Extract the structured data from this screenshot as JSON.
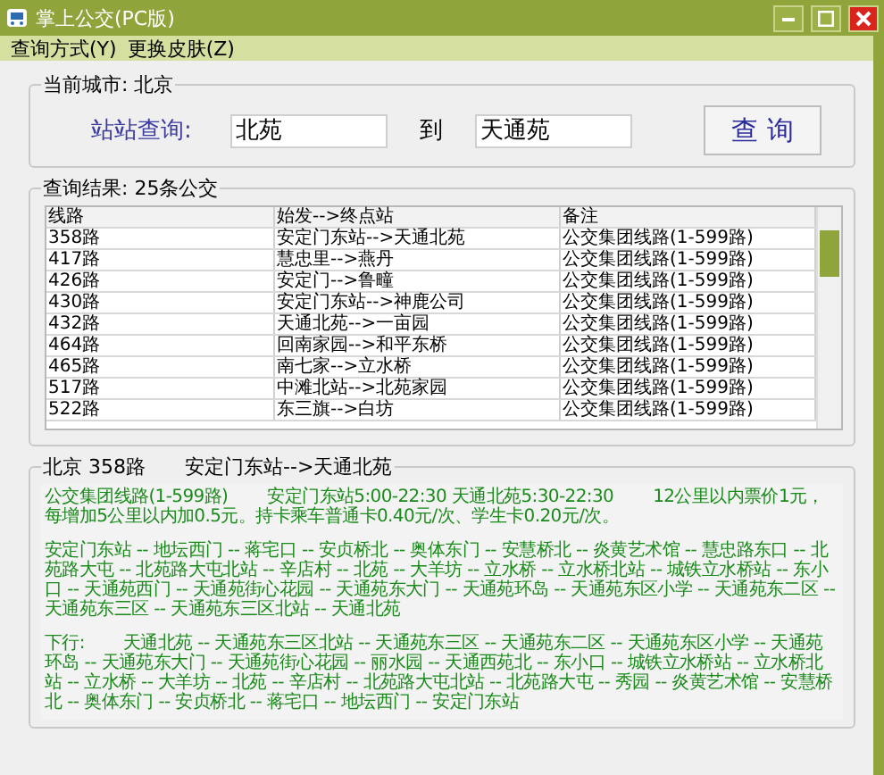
{
  "window": {
    "title": "掌上公交(PC版)"
  },
  "menu": [
    "查询方式(Y)",
    "更换皮肤(Z)"
  ],
  "query": {
    "legend": "当前城市: 北京",
    "label": "站站查询:",
    "from": "北苑",
    "to_label": "到",
    "to": "天通苑",
    "button": "查 询"
  },
  "results": {
    "legend": "查询结果: 25条公交",
    "columns": [
      "线路",
      "始发-->终点站",
      "备注"
    ],
    "rows": [
      [
        "358路",
        "安定门东站-->天通北苑",
        "公交集团线路(1-599路)"
      ],
      [
        "417路",
        "慧忠里-->燕丹",
        "公交集团线路(1-599路)"
      ],
      [
        "426路",
        "安定门-->鲁疃",
        "公交集团线路(1-599路)"
      ],
      [
        "430路",
        "安定门东站-->神鹿公司",
        "公交集团线路(1-599路)"
      ],
      [
        "432路",
        "天通北苑-->一亩园",
        "公交集团线路(1-599路)"
      ],
      [
        "464路",
        "回南家园-->和平东桥",
        "公交集团线路(1-599路)"
      ],
      [
        "465路",
        "南七家-->立水桥",
        "公交集团线路(1-599路)"
      ],
      [
        "517路",
        "中滩北站-->北苑家园",
        "公交集团线路(1-599路)"
      ],
      [
        "522路",
        "东三旗-->白坊",
        "公交集团线路(1-599路)"
      ]
    ]
  },
  "detail": {
    "legend": [
      "北京 358路",
      "安定门东站-->天通北苑"
    ],
    "info": [
      "公交集团线路(1-599路)",
      "安定门东站5:00-22:30 天通北苑5:30-22:30",
      "12公里以内票价1元，每增加5公里以内加0.5元。持卡乘车普通卡0.40元/次、学生卡0.20元/次。"
    ],
    "up_stops": "安定门东站 -- 地坛西门 -- 蒋宅口 -- 安贞桥北 -- 奥体东门 -- 安慧桥北 -- 炎黄艺术馆 -- 慧忠路东口 -- 北苑路大屯 -- 北苑路大屯北站 -- 辛店村 -- 北苑 -- 大羊坊 -- 立水桥 -- 立水桥北站 -- 城铁立水桥站 -- 东小口 -- 天通苑西门 -- 天通苑街心花园 -- 天通苑东大门 -- 天通苑环岛 -- 天通苑东区小学 -- 天通苑东二区 -- 天通苑东三区 -- 天通苑东三区北站 -- 天通北苑",
    "down_label": "下行:",
    "down_stops": "天通北苑 -- 天通苑东三区北站 -- 天通苑东三区 -- 天通苑东二区 -- 天通苑东区小学 -- 天通苑环岛 -- 天通苑东大门 -- 天通苑街心花园 -- 丽水园 -- 天通西苑北 -- 东小口 -- 城铁立水桥站 -- 立水桥北站 -- 立水桥 -- 大羊坊 -- 北苑 -- 辛店村 -- 北苑路大屯北站 -- 北苑路大屯 -- 秀园 -- 炎黄艺术馆 -- 安慧桥北 -- 奥体东门 -- 安贞桥北 -- 蒋宅口 -- 地坛西门 -- 安定门东站"
  }
}
